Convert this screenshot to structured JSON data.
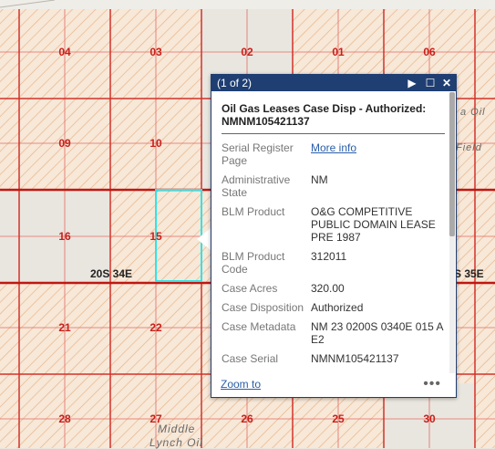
{
  "map": {
    "sections": [
      "04",
      "03",
      "02",
      "01",
      "06",
      "09",
      "10",
      "16",
      "15",
      "21",
      "22",
      "28",
      "27",
      "26",
      "25",
      "30"
    ],
    "townships": [
      "20S 34E",
      "S 35E"
    ],
    "places": [
      "a Oil",
      "Field",
      "Middle",
      "Lynch Oil"
    ]
  },
  "popup": {
    "counter": "(1 of 2)",
    "next_icon": "▶",
    "maximize_icon": "☐",
    "close_icon": "✕",
    "title": "Oil Gas Leases Case Disp - Authorized: NMNM105421137",
    "fields": [
      {
        "key": "Serial Register Page",
        "value": "More info",
        "link": true
      },
      {
        "key": "Administrative State",
        "value": "NM"
      },
      {
        "key": "BLM Product",
        "value": "O&G COMPETITIVE PUBLIC DOMAIN LEASE PRE 1987"
      },
      {
        "key": "BLM Product Code",
        "value": "312011"
      },
      {
        "key": "Case Acres",
        "value": "320.00"
      },
      {
        "key": "Case Disposition",
        "value": "Authorized"
      },
      {
        "key": "Case Metadata",
        "value": "NM 23 0200S 0340E 015 A E2"
      },
      {
        "key": "Case Serial",
        "value": "NMNM105421137"
      }
    ],
    "zoom_label": "Zoom to",
    "more_label": "•••"
  }
}
